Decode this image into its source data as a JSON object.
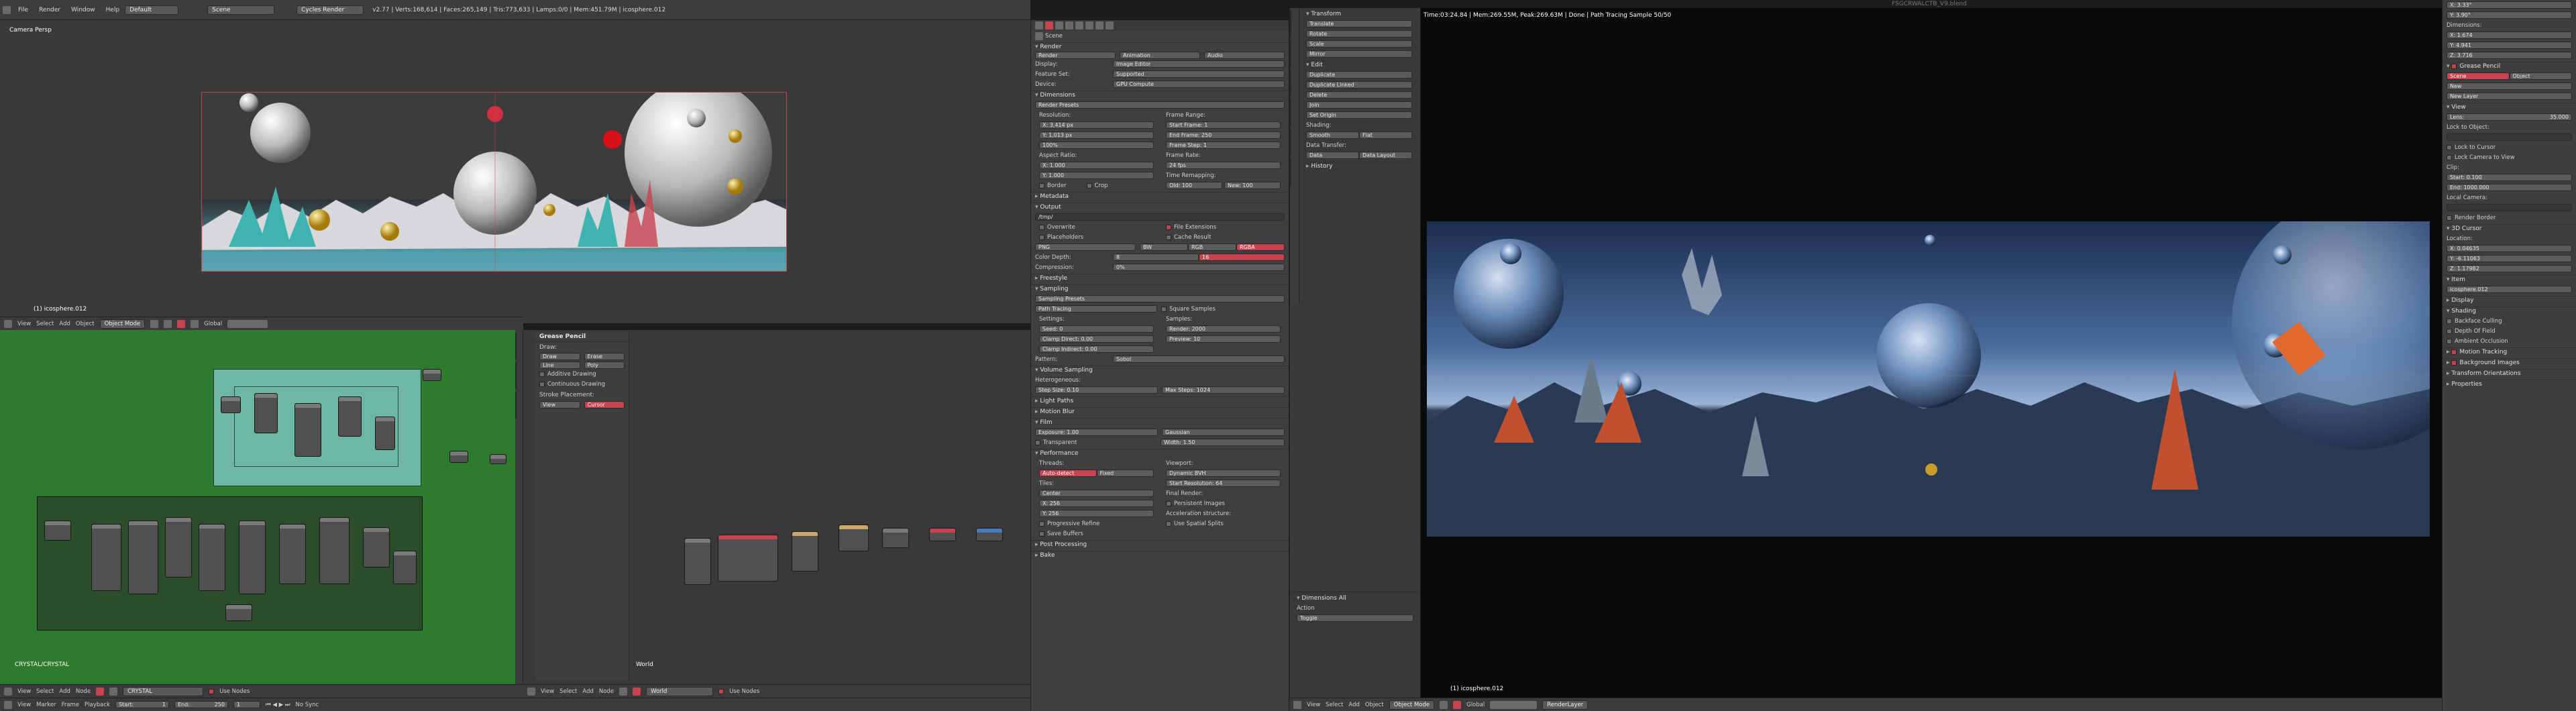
{
  "top_bar": {
    "menus": [
      "File",
      "Render",
      "Window",
      "Help"
    ],
    "layout": "Default",
    "scene": "Scene",
    "engine": "Cycles Render",
    "stats": "v2.77 | Verts:168,614 | Faces:265,149 | Tris:773,633 | Lamps:0/0 | Mem:451.79M | icosphere.012",
    "file_title": "FSGCRWALCTB_V9.blend"
  },
  "viewport": {
    "label": "Camera Persp",
    "object_label": "(1) icosphere.012"
  },
  "viewport_header": {
    "items": [
      "View",
      "Select",
      "Add",
      "Object"
    ],
    "mode": "Object Mode",
    "pivot": "Global"
  },
  "node_editor": {
    "frame_label": "CRYSTAL/CRYSTAL",
    "header_items": [
      "View",
      "Select",
      "Add",
      "Node"
    ],
    "material": "CRYSTAL",
    "use_nodes": "Use Nodes"
  },
  "grease_pencil_panel": {
    "title": "Grease Pencil",
    "draw_label": "Draw:",
    "buttons": [
      "Draw",
      "Erase",
      "Line",
      "Poly"
    ],
    "options": [
      "Additive Drawing",
      "Continuous Drawing"
    ],
    "stroke_label": "Stroke Placement:",
    "placement": [
      "View",
      "Cursor"
    ]
  },
  "world_editor": {
    "label": "World",
    "header_items": [
      "View",
      "Select",
      "Add",
      "Node"
    ],
    "world": "World",
    "use_nodes": "Use Nodes"
  },
  "timeline": {
    "items": [
      "View",
      "Marker",
      "Frame",
      "Playback"
    ],
    "start_label": "Start:",
    "start": "1",
    "end_label": "End:",
    "end": "250",
    "current": "1",
    "sync": "No Sync"
  },
  "properties": {
    "scene_label": "Scene",
    "render_header": "Render",
    "render_buttons": [
      "Render",
      "Animation",
      "Audio"
    ],
    "display_label": "Display:",
    "display_value": "Image Editor",
    "feature_label": "Feature Set:",
    "feature_value": "Supported",
    "device_label": "Device:",
    "device_value": "GPU Compute",
    "dimensions_header": "Dimensions",
    "render_presets": "Render Presets",
    "resolution_label": "Resolution:",
    "res_x": "X: 3,414 px",
    "res_y": "Y: 1,013 px",
    "res_pct": "100%",
    "frame_range_label": "Frame Range:",
    "start_frame": "Start Frame: 1",
    "end_frame": "End Frame: 250",
    "frame_step": "Frame Step: 1",
    "aspect_label": "Aspect Ratio:",
    "aspect_x": "X: 1.000",
    "aspect_y": "Y: 1.000",
    "frame_rate_label": "Frame Rate:",
    "frame_rate": "24 fps",
    "time_remap": "Time Remapping:",
    "remap_old": "Old: 100",
    "remap_new": "New: 100",
    "border": "Border",
    "crop": "Crop",
    "metadata_header": "Metadata",
    "output_header": "Output",
    "output_path": "/tmp/",
    "overwrite": "Overwrite",
    "file_ext": "File Extensions",
    "placeholders": "Placeholders",
    "cache_result": "Cache Result",
    "format": "PNG",
    "color_modes": [
      "BW",
      "RGB",
      "RGBA"
    ],
    "color_depth_label": "Color Depth:",
    "color_depths": [
      "8",
      "16"
    ],
    "compression_label": "Compression:",
    "compression": "0%",
    "freestyle_header": "Freestyle",
    "sampling_header": "Sampling",
    "sampling_presets": "Sampling Presets",
    "path_tracing": "Path Tracing",
    "square_samples": "Square Samples",
    "settings_label": "Settings:",
    "samples_label": "Samples:",
    "seed": "Seed: 0",
    "clamp_direct": "Clamp Direct: 0.00",
    "clamp_indirect": "Clamp Indirect: 0.00",
    "render_samples": "Render: 2000",
    "preview_samples": "Preview: 10",
    "pattern_label": "Pattern:",
    "pattern_value": "Sobol",
    "volume_header": "Volume Sampling",
    "heterogeneous": "Heterogeneous:",
    "step_size": "Step Size: 0.10",
    "max_steps": "Max Steps: 1024",
    "light_paths_header": "Light Paths",
    "motion_blur_header": "Motion Blur",
    "film_header": "Film",
    "exposure": "Exposure: 1.00",
    "filter_label": "Gaussian",
    "filter_width": "Width: 1.50",
    "transparent": "Transparent",
    "performance_header": "Performance",
    "threads_label": "Threads:",
    "threads_modes": [
      "Auto-detect",
      "Fixed"
    ],
    "viewport_label": "Viewport:",
    "viewport_bvh": "Dynamic BVH",
    "tiles_label": "Tiles:",
    "center": "Center",
    "tile_x": "X: 256",
    "tile_y": "Y: 256",
    "start_res": "Start Resolution: 64",
    "final_render": "Final Render:",
    "persistent_images": "Persistent Images",
    "progressive_refine": "Progressive Refine",
    "save_buffers": "Save Buffers",
    "accel_label": "Acceleration structure:",
    "spatial_splits": "Use Spatial Splits",
    "post_processing_header": "Post Processing",
    "bake_header": "Bake"
  },
  "tool_shelf": {
    "transform_header": "Transform",
    "transform_items": [
      "Translate",
      "Rotate",
      "Scale",
      "Mirror"
    ],
    "edit_header": "Edit",
    "edit_items": [
      "Duplicate",
      "Duplicate Linked",
      "Delete",
      "Join"
    ],
    "set_origin": "Set Origin",
    "shading_label": "Shading:",
    "shading_buttons": [
      "Smooth",
      "Flat"
    ],
    "data_transfer": "Data Transfer:",
    "data_buttons": [
      "Data",
      "Data Layout"
    ],
    "history_header": "History",
    "operator_header": "Dimensions All",
    "action_label": "Action",
    "action_value": "Toggle"
  },
  "render_view": {
    "stats": "Time:03:24.84 | Mem:269.55M, Peak:269.63M | Done | Path Tracing Sample 50/50",
    "object_label": "(1) icosphere.012"
  },
  "render_view_header": {
    "items": [
      "View",
      "Select",
      "Add",
      "Object"
    ],
    "mode": "Object Mode",
    "pivot": "Global",
    "layer": "RenderLayer"
  },
  "n_panel": {
    "rot_x": "X: 3.33°",
    "rot_y": "Y: 3.90°",
    "dimensions_header": "Dimensions:",
    "dim_x": "X: 1.674",
    "dim_y": "Y: 4.941",
    "dim_z": "Z: 3.716",
    "grease_pencil_header": "Grease Pencil",
    "gp_buttons": [
      "Scene",
      "Object"
    ],
    "gp_new": "New",
    "gp_new_layer": "New Layer",
    "view_header": "View",
    "lens_label": "Lens:",
    "lens": "35.000",
    "lock_to_object": "Lock to Object:",
    "lock_to_cursor": "Lock to Cursor",
    "lock_camera": "Lock Camera to View",
    "clip_label": "Clip:",
    "clip_start": "Start: 0.100",
    "clip_end": "End: 1000.000",
    "local_camera": "Local Camera:",
    "render_border": "Render Border",
    "cursor_header": "3D Cursor",
    "location_label": "Location:",
    "loc_x": "X: 0.04635",
    "loc_y": "Y: -6.11063",
    "loc_z": "Z: 1.17982",
    "item_header": "Item",
    "item_name": "icosphere.012",
    "display_header": "Display",
    "shading_header": "Shading",
    "shading_opts": [
      "Backface Culling",
      "Depth Of Field",
      "Ambient Occlusion"
    ],
    "motion_tracking": "Motion Tracking",
    "background_images": "Background Images",
    "transform_orient": "Transform Orientations",
    "properties_header": "Properties"
  }
}
